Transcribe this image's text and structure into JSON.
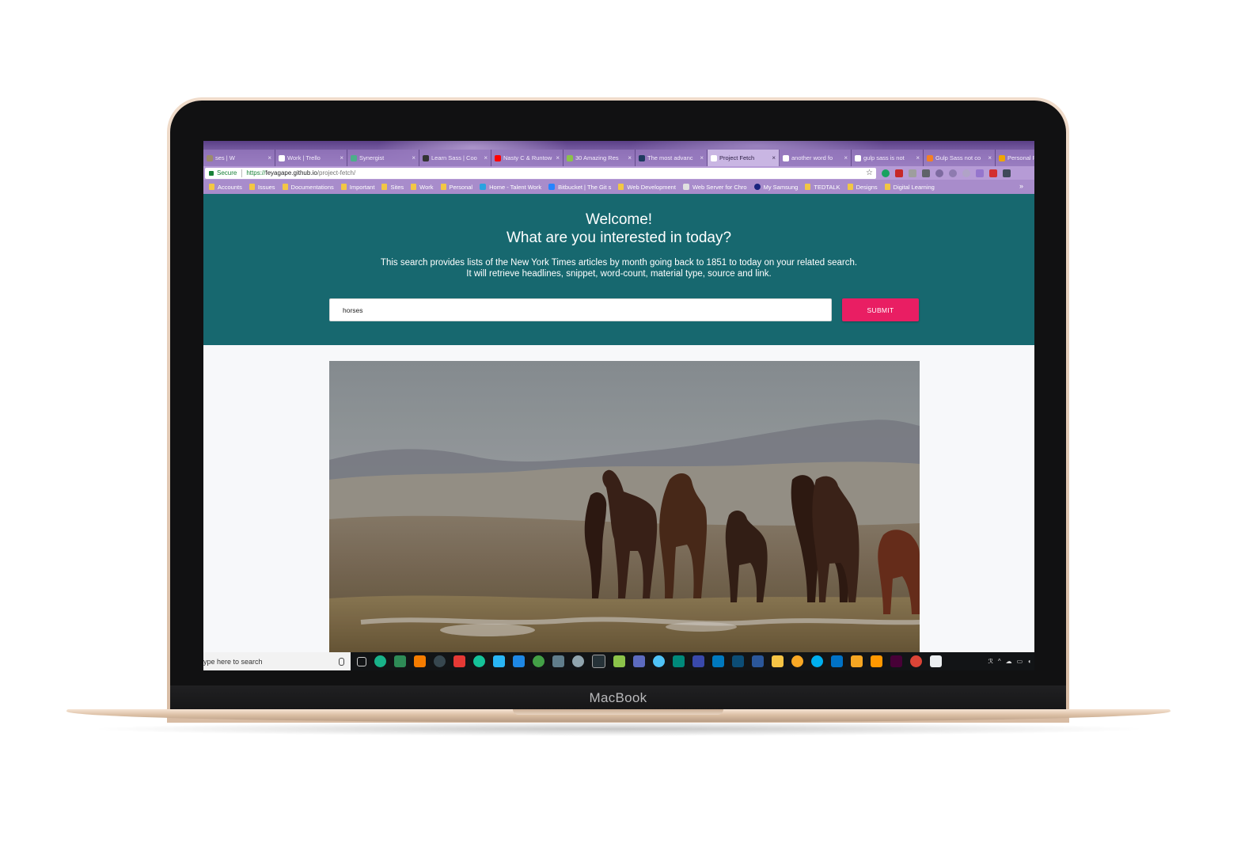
{
  "device": {
    "label": "MacBook"
  },
  "browser": {
    "tabs": [
      {
        "title": "ses | W",
        "favicon": "cookie-icon",
        "color": "#9c8b6c"
      },
      {
        "title": "Work | Trello",
        "favicon": "trello-icon",
        "color": "#ffffff"
      },
      {
        "title": "Synergist",
        "favicon": "synergist-icon",
        "color": "#4caf8a"
      },
      {
        "title": "Learn Sass | Coo",
        "favicon": "codecademy-icon",
        "color": "#333333"
      },
      {
        "title": "Nasty C & Runtow",
        "favicon": "youtube-icon",
        "color": "#ff0000"
      },
      {
        "title": "30 Amazing Res",
        "favicon": "dribbble-icon",
        "color": "#8bc34a"
      },
      {
        "title": "The most advanc",
        "favicon": "f-icon",
        "color": "#1e3a5f"
      },
      {
        "title": "Project Fetch",
        "favicon": "page-icon",
        "color": "#ffffff",
        "active": true
      },
      {
        "title": "another word fo",
        "favicon": "google-icon",
        "color": "#ffffff"
      },
      {
        "title": "gulp sass is not",
        "favicon": "google-icon",
        "color": "#ffffff"
      },
      {
        "title": "Gulp Sass not co",
        "favicon": "stackoverflow-icon",
        "color": "#f48024"
      },
      {
        "title": "Personal Portfoli",
        "favicon": "f-icon",
        "color": "#f0a500"
      }
    ],
    "close_glyph": "×",
    "address": {
      "secure_label": "Secure",
      "url_scheme": "https://",
      "url_host": "feyagape.github.io",
      "url_path": "/project-fetch/"
    },
    "bookmarks": [
      {
        "label": "Accounts",
        "icon": "folder-icon"
      },
      {
        "label": "Issues",
        "icon": "folder-icon"
      },
      {
        "label": "Documentations",
        "icon": "folder-icon"
      },
      {
        "label": "Important",
        "icon": "folder-icon"
      },
      {
        "label": "Sites",
        "icon": "folder-icon"
      },
      {
        "label": "Work",
        "icon": "folder-icon"
      },
      {
        "label": "Personal",
        "icon": "folder-icon"
      },
      {
        "label": "Home - Talent Work",
        "icon": "t-icon"
      },
      {
        "label": "Bitbucket | The Git s",
        "icon": "bitbucket-icon"
      },
      {
        "label": "Web Development",
        "icon": "folder-icon"
      },
      {
        "label": "Web Server for Chro",
        "icon": "server-icon"
      },
      {
        "label": "My Samsung",
        "icon": "s-icon"
      },
      {
        "label": "TEDTALK",
        "icon": "folder-icon"
      },
      {
        "label": "Designs",
        "icon": "folder-icon"
      },
      {
        "label": "Digital Learning",
        "icon": "folder-icon"
      }
    ],
    "bookmarks_overflow": "»"
  },
  "page": {
    "heading_line1": "Welcome!",
    "heading_line2": "What are you interested in today?",
    "description_line1": "This search provides lists of the New York Times articles by month going back to 1851 to today on your related search.",
    "description_line2": "It will retrieve headlines, snippet, word-count, material type, source and link.",
    "search": {
      "value": "horses"
    },
    "submit_label": "SUBMIT",
    "accent_color": "#e91e63",
    "header_color": "#17686f"
  },
  "taskbar": {
    "search_placeholder": "ype here to search"
  }
}
